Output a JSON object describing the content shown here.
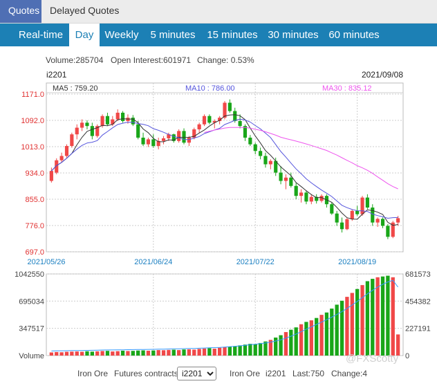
{
  "top_tabs": [
    "Quotes",
    "Delayed Quotes"
  ],
  "nav_tabs": [
    "Real-time",
    "Day",
    "Weekly",
    "5 minutes",
    "15 minutes",
    "30 minutes",
    "60 minutes"
  ],
  "active_nav_tab": "Day",
  "info": {
    "volume": "Volume:285704",
    "open_interest": "Open Interest:601971",
    "change": "Change: 0.53%"
  },
  "chart_header": {
    "symbol": "i2201",
    "date": "2021/09/08"
  },
  "ma_labels": {
    "ma5": "MA5 : 759.20",
    "ma10": "MA10 : 786.00",
    "ma30": "MA30 : 835.12"
  },
  "bottom": {
    "product": "Iron Ore",
    "futures_label": "Futures contracts",
    "selected_contract": "i2201",
    "summary_product": "Iron Ore",
    "summary_symbol": "i2201",
    "last": "Last:750",
    "change": "Change:4"
  },
  "watermark": "@FXScotty",
  "colors": {
    "up": "#f04848",
    "down": "#19a619",
    "ma5": "#333333",
    "ma10": "#5555dd",
    "ma30": "#ee55ee",
    "oi_line": "#3399ff",
    "nav": "#1c80b5",
    "active_top_tab": "#4f6fb4"
  },
  "chart_data": [
    {
      "type": "candlestick",
      "title": "i2201",
      "x_tick_labels": [
        "2021/05/26",
        "2021/06/24",
        "2021/07/22",
        "2021/08/19"
      ],
      "y_tick_labels": [
        "1171.0",
        "1092.0",
        "1013.0",
        "934.0",
        "855.0",
        "776.0",
        "697.0"
      ],
      "ylim": [
        697,
        1171
      ],
      "ohlc": [
        [
          910,
          950,
          905,
          940
        ],
        [
          935,
          978,
          930,
          972
        ],
        [
          972,
          995,
          965,
          985
        ],
        [
          985,
          1020,
          980,
          1015
        ],
        [
          1015,
          1055,
          1010,
          1050
        ],
        [
          1050,
          1080,
          1035,
          1070
        ],
        [
          1070,
          1095,
          1060,
          1085
        ],
        [
          1085,
          1092,
          1065,
          1075
        ],
        [
          1075,
          1085,
          1035,
          1045
        ],
        [
          1045,
          1080,
          1040,
          1075
        ],
        [
          1075,
          1110,
          1070,
          1105
        ],
        [
          1105,
          1115,
          1075,
          1080
        ],
        [
          1080,
          1105,
          1075,
          1095
        ],
        [
          1095,
          1125,
          1090,
          1115
        ],
        [
          1115,
          1120,
          1085,
          1090
        ],
        [
          1090,
          1110,
          1082,
          1100
        ],
        [
          1100,
          1108,
          1075,
          1080
        ],
        [
          1080,
          1090,
          1035,
          1040
        ],
        [
          1040,
          1055,
          1015,
          1020
        ],
        [
          1020,
          1040,
          1012,
          1035
        ],
        [
          1035,
          1050,
          1010,
          1015
        ],
        [
          1015,
          1040,
          1005,
          1030
        ],
        [
          1030,
          1045,
          1020,
          1038
        ],
        [
          1038,
          1055,
          1030,
          1050
        ],
        [
          1050,
          1052,
          1025,
          1030
        ],
        [
          1030,
          1065,
          1025,
          1060
        ],
        [
          1060,
          1068,
          1020,
          1025
        ],
        [
          1025,
          1045,
          1015,
          1040
        ],
        [
          1040,
          1070,
          1035,
          1065
        ],
        [
          1065,
          1085,
          1055,
          1080
        ],
        [
          1080,
          1110,
          1075,
          1105
        ],
        [
          1105,
          1110,
          1080,
          1085
        ],
        [
          1085,
          1095,
          1068,
          1090
        ],
        [
          1090,
          1105,
          1080,
          1100
        ],
        [
          1100,
          1150,
          1095,
          1145
        ],
        [
          1145,
          1155,
          1115,
          1120
        ],
        [
          1120,
          1130,
          1085,
          1090
        ],
        [
          1090,
          1110,
          1068,
          1075
        ],
        [
          1075,
          1080,
          1030,
          1040
        ],
        [
          1040,
          1048,
          1015,
          1020
        ],
        [
          1020,
          1025,
          990,
          1000
        ],
        [
          1000,
          1010,
          975,
          985
        ],
        [
          985,
          995,
          950,
          960
        ],
        [
          960,
          975,
          945,
          970
        ],
        [
          970,
          980,
          925,
          935
        ],
        [
          935,
          955,
          900,
          910
        ],
        [
          910,
          930,
          885,
          920
        ],
        [
          920,
          935,
          890,
          895
        ],
        [
          895,
          905,
          855,
          865
        ],
        [
          865,
          885,
          845,
          875
        ],
        [
          875,
          880,
          840,
          848
        ],
        [
          848,
          870,
          840,
          862
        ],
        [
          862,
          870,
          842,
          850
        ],
        [
          850,
          870,
          845,
          865
        ],
        [
          865,
          870,
          830,
          840
        ],
        [
          840,
          845,
          808,
          812
        ],
        [
          812,
          820,
          775,
          785
        ],
        [
          785,
          800,
          755,
          765
        ],
        [
          765,
          800,
          762,
          795
        ],
        [
          795,
          825,
          790,
          820
        ],
        [
          820,
          835,
          805,
          810
        ],
        [
          810,
          865,
          805,
          860
        ],
        [
          860,
          870,
          825,
          830
        ],
        [
          830,
          840,
          775,
          785
        ],
        [
          785,
          800,
          772,
          796
        ],
        [
          796,
          800,
          768,
          775
        ],
        [
          775,
          780,
          735,
          742
        ],
        [
          742,
          790,
          738,
          785
        ],
        [
          785,
          805,
          775,
          798
        ]
      ],
      "ma5": [
        880,
        893,
        906,
        925,
        950,
        975,
        999,
        1021,
        1040,
        1058,
        1070,
        1078,
        1082,
        1086,
        1090,
        1093,
        1094,
        1091,
        1086,
        1078,
        1070,
        1062,
        1052,
        1046,
        1040,
        1038,
        1040,
        1042,
        1044,
        1049,
        1056,
        1064,
        1071,
        1080,
        1089,
        1098,
        1105,
        1110,
        1110,
        1106,
        1096,
        1080,
        1065,
        1050,
        1034,
        1017,
        1000,
        985,
        972,
        960,
        950,
        940,
        930,
        921,
        913,
        904,
        893,
        880,
        868,
        857,
        847,
        841,
        835,
        831,
        827,
        822,
        815,
        807,
        800
      ],
      "ma10": [],
      "ma30": []
    },
    {
      "type": "bar",
      "title": "Volume",
      "y_tick_labels_left": [
        "1042550",
        "695034",
        "347517",
        "Volume"
      ],
      "y_tick_labels_right": [
        "681573",
        "454382",
        "227191",
        "0"
      ],
      "ylim_left": [
        0,
        1042550
      ],
      "ylim_right": [
        0,
        681573
      ],
      "volume": [
        40,
        45,
        42,
        48,
        50,
        52,
        48,
        55,
        50,
        54,
        58,
        60,
        52,
        56,
        62,
        58,
        60,
        64,
        66,
        62,
        65,
        70,
        68,
        72,
        75,
        70,
        78,
        80,
        76,
        85,
        90,
        95,
        88,
        100,
        110,
        115,
        120,
        130,
        140,
        150,
        145,
        160,
        180,
        200,
        230,
        260,
        300,
        330,
        360,
        400,
        430,
        450,
        480,
        520,
        550,
        600,
        650,
        700,
        750,
        800,
        850,
        900,
        950,
        980,
        1000,
        1010,
        1020,
        1000,
        270
      ],
      "open_interest": []
    }
  ]
}
